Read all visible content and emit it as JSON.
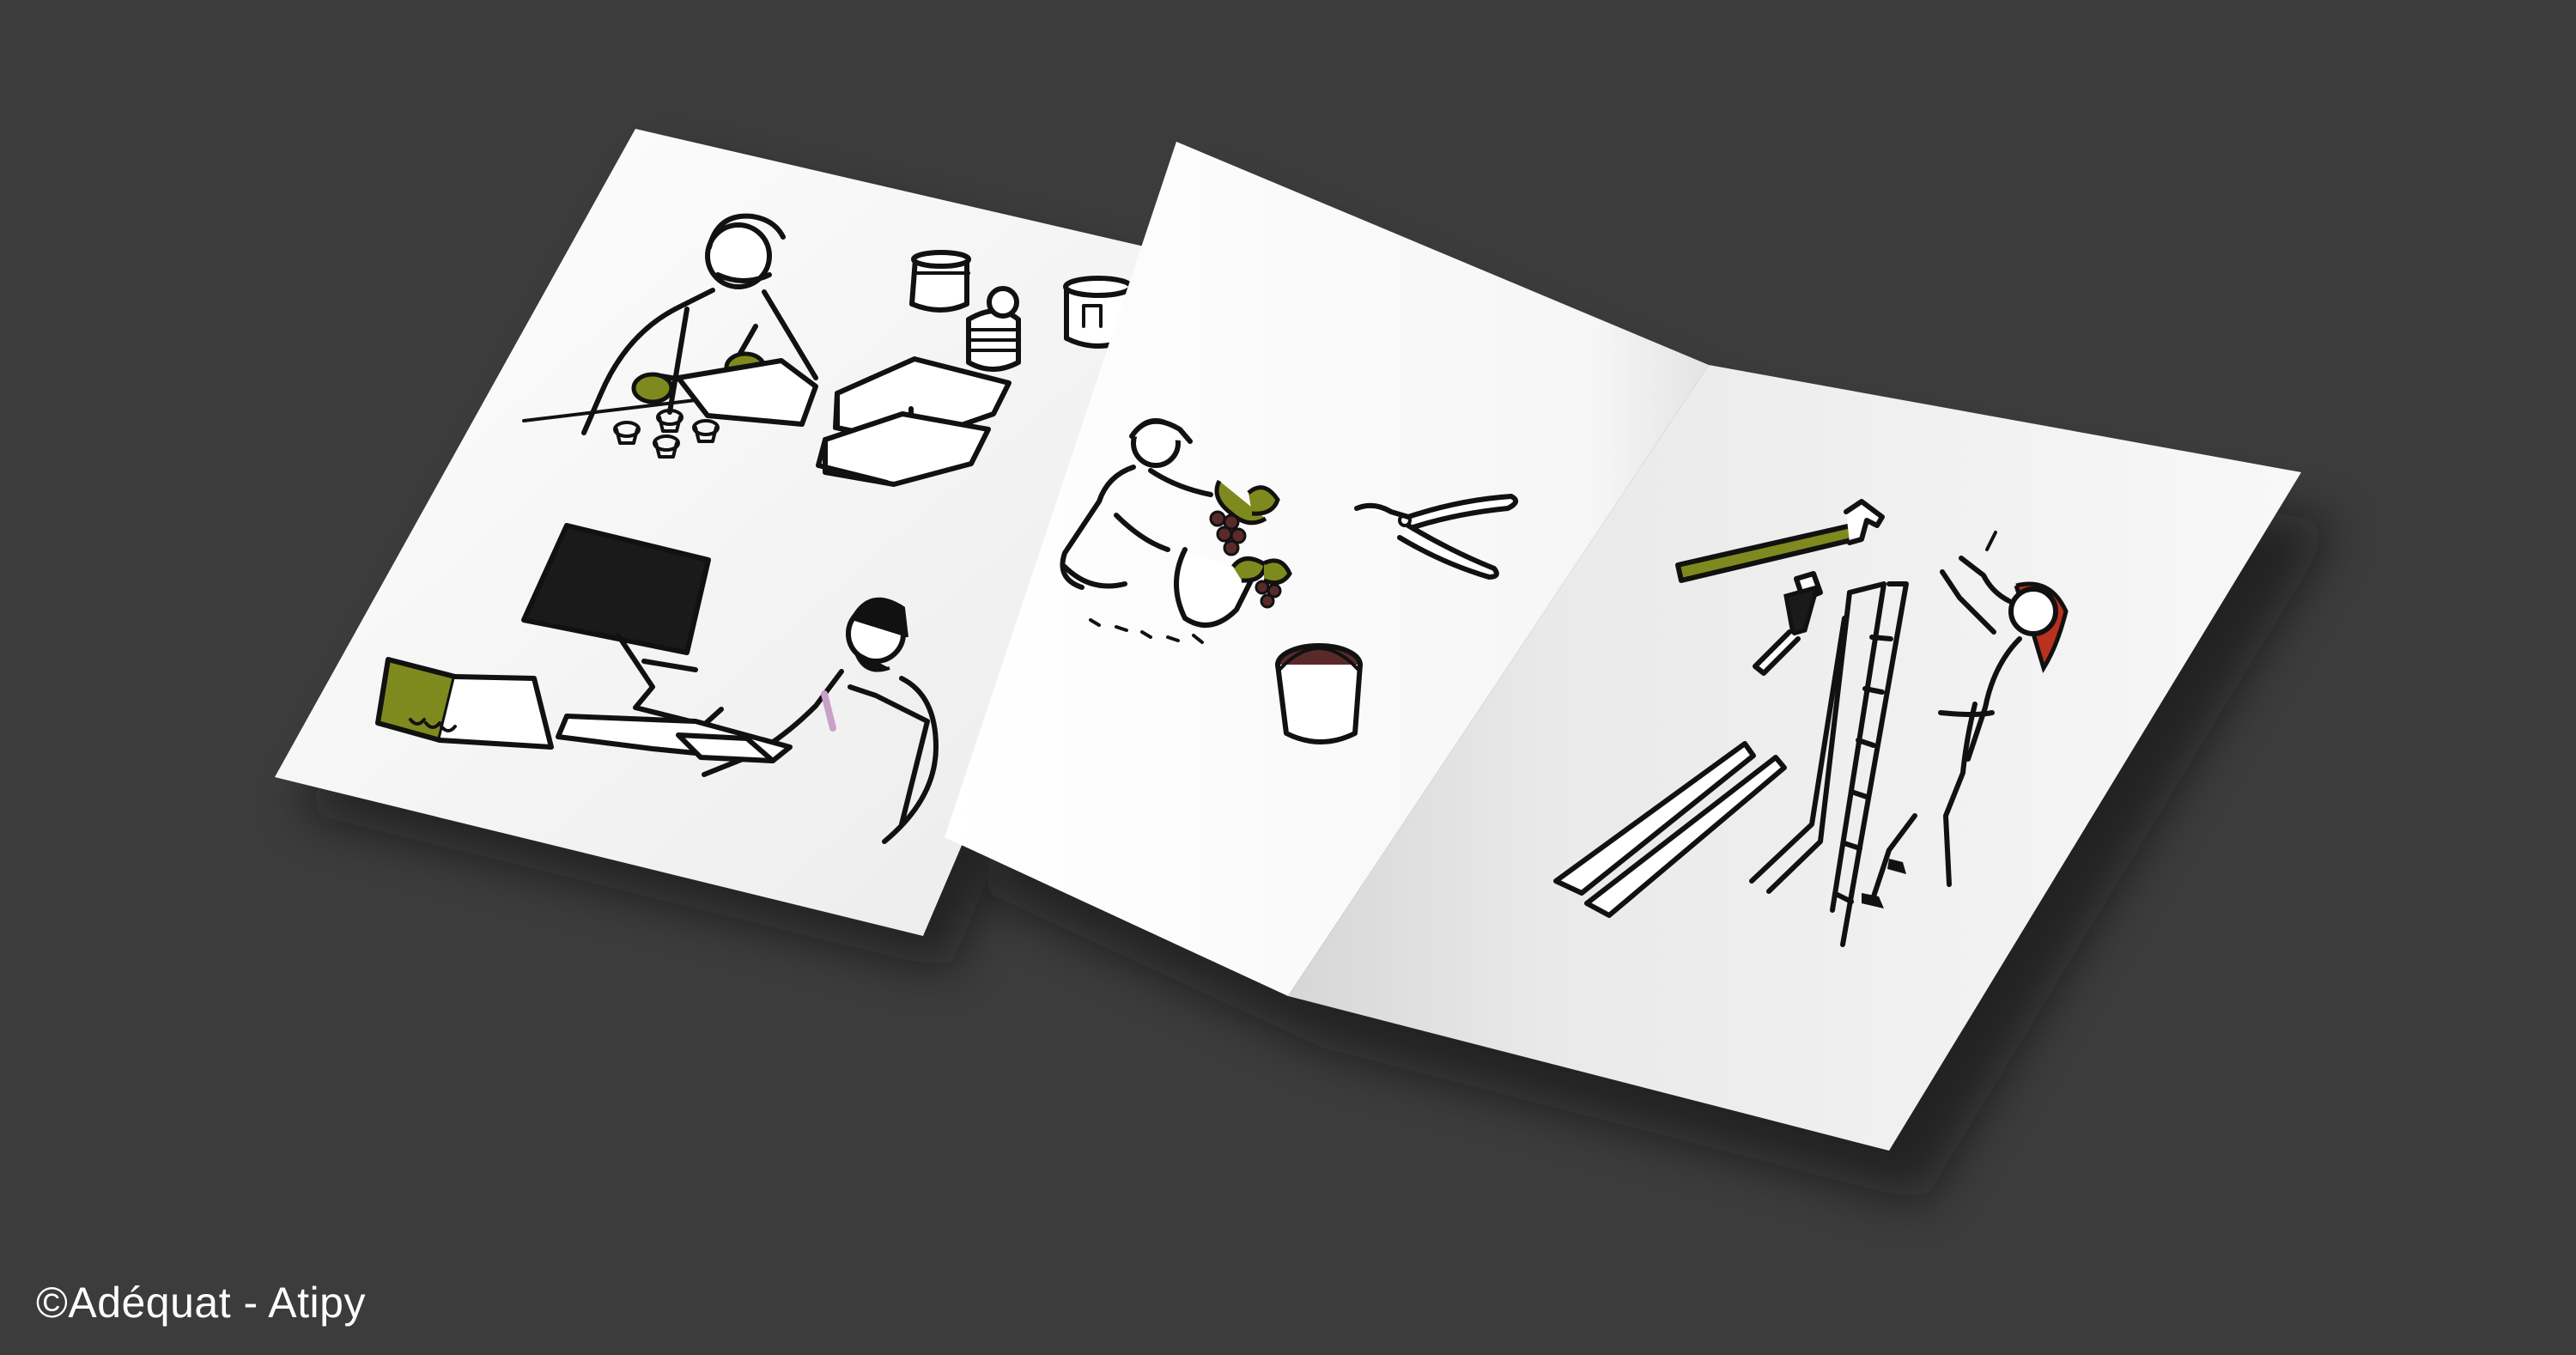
{
  "credit": {
    "text": "©Adéquat - Atipy"
  },
  "colors": {
    "background": "#3c3c3c",
    "paper": "#f4f4f4",
    "olive_accent": "#7f8a1e",
    "grape": "#5a2a2a",
    "hair_red": "#b8321e",
    "line": "#111111"
  },
  "illustrations": {
    "left_sheet": [
      "food-packer-icon",
      "jars-and-cans-icon",
      "stacked-boxes-icon",
      "office-worker-icon",
      "computer-monitor-icon",
      "ring-binder-icon"
    ],
    "brochure_left_page": [
      "grape-harvester-icon",
      "pruning-shears-icon",
      "grape-bucket-icon"
    ],
    "brochure_right_page": [
      "hammer-icon",
      "paintbrush-icon",
      "ladder-icon",
      "woman-on-ladder-icon"
    ]
  }
}
